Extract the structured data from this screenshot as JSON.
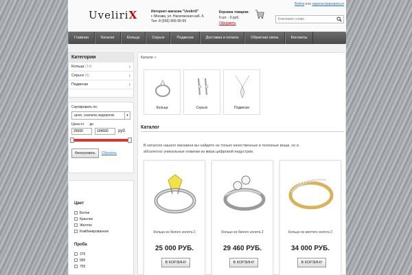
{
  "header": {
    "login_link": "Войти",
    "or_text": "или",
    "register_link": "зарегистрироваться",
    "logo_main": "Uveliri",
    "logo_accent": "X",
    "shop_title": "Интернет-магазин \"UveliriX\"",
    "shop_address": "г. Москва, ул. Нагатинская наб. 4.",
    "shop_phone": "Тел. 8 (555) 555-55-55",
    "cart_title": "Корзина товаров:",
    "cart_count": "0 шт. - 0 руб.",
    "cart_link": "Оформить",
    "search_placeholder": "Ключевое слово"
  },
  "nav": {
    "items": [
      "Главная",
      "Каталог",
      "Кольца",
      "Серьги",
      "Подвески",
      "Доставка и оплата",
      "Обратная связь",
      "Контакты"
    ]
  },
  "sidebar": {
    "categories_title": "Категории",
    "categories": [
      {
        "label": "Кольца",
        "count": "(14)"
      },
      {
        "label": "Серьги",
        "count": "(6)"
      },
      {
        "label": "Подвески",
        "count": ""
      }
    ],
    "sort_label": "Сортировать по:",
    "sort_value": "цене, сначала недорогие",
    "price_from_label": "Цена от",
    "price_to_label": "до",
    "price_from": "25000",
    "price_to": "194500",
    "currency": "руб.",
    "filter_button": "Фильтровать",
    "reset_link": "Сбросить",
    "color_title": "Цвет",
    "colors": [
      "Белое",
      "Красное",
      "Желтое",
      "Комбинированное"
    ],
    "proba_title": "Проба",
    "probas": [
      "375",
      "585",
      "750"
    ]
  },
  "main": {
    "breadcrumb": "Каталог »",
    "subcategories": [
      "Кольца",
      "Серьги",
      "Подвески"
    ],
    "title": "Каталог",
    "intro": "В каталоге нашего магазина вы найдете не только качественные и полезные вещи, но и абсолютно уникальные новинки из мира цифровой индустрии.",
    "products": [
      {
        "name": "Кольцо из белого золота 2",
        "price": "25 000 РУБ.",
        "button": "В КОРЗИНУ"
      },
      {
        "name": "Кольцо из белого золота 2",
        "price": "29 460 РУБ.",
        "button": "В КОРЗИНУ"
      },
      {
        "name": "Кольцо из желтого золота 2",
        "price": "34 000 РУБ.",
        "button": "В КОРЗИНУ"
      }
    ]
  },
  "colors": {
    "accent": "#cc0000",
    "link": "#2a6fc9",
    "nav_bg": "#555555",
    "slider": "#dd3333"
  }
}
